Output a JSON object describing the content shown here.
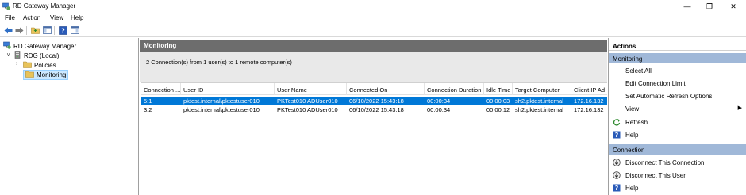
{
  "window": {
    "title": "RD Gateway Manager"
  },
  "menu": [
    "File",
    "Action",
    "View",
    "Help"
  ],
  "tree": {
    "root": "RD Gateway Manager",
    "server": "RDG (Local)",
    "policies": "Policies",
    "monitoring": "Monitoring"
  },
  "center": {
    "header": "Monitoring",
    "summary": "2 Connection(s) from 1 user(s) to 1 remote computer(s)",
    "columns": [
      "Connection ...",
      "User ID",
      "User Name",
      "Connected On",
      "Connection Duration",
      "Idle Time",
      "Target Computer",
      "Client IP Ad"
    ],
    "rows": [
      [
        "5:1",
        "pktest.internal\\pktestuser010",
        "PKTest010 ADUser010",
        "06/10/2022 15:43:18",
        "00:00:34",
        "00:00:03",
        "sh2.pktest.internal",
        "172.16.132"
      ],
      [
        "3:2",
        "pktest.internal\\pktestuser010",
        "PKTest010 ADUser010",
        "06/10/2022 15:43:18",
        "00:00:34",
        "00:00:12",
        "sh2.pktest.internal",
        "172.16.132"
      ]
    ]
  },
  "actions": {
    "title": "Actions",
    "monitoring_section": "Monitoring",
    "monitoring_items": [
      "Select All",
      "Edit Connection Limit",
      "Set Automatic Refresh Options",
      "View",
      "Refresh",
      "Help"
    ],
    "connection_section": "Connection",
    "connection_items": [
      "Disconnect This Connection",
      "Disconnect This User",
      "Help"
    ]
  },
  "colors": {
    "selection": "#0078d7",
    "header_band": "#6d6d6d",
    "action_section": "#a0b8d8",
    "tree_selection": "#cce8ff"
  }
}
